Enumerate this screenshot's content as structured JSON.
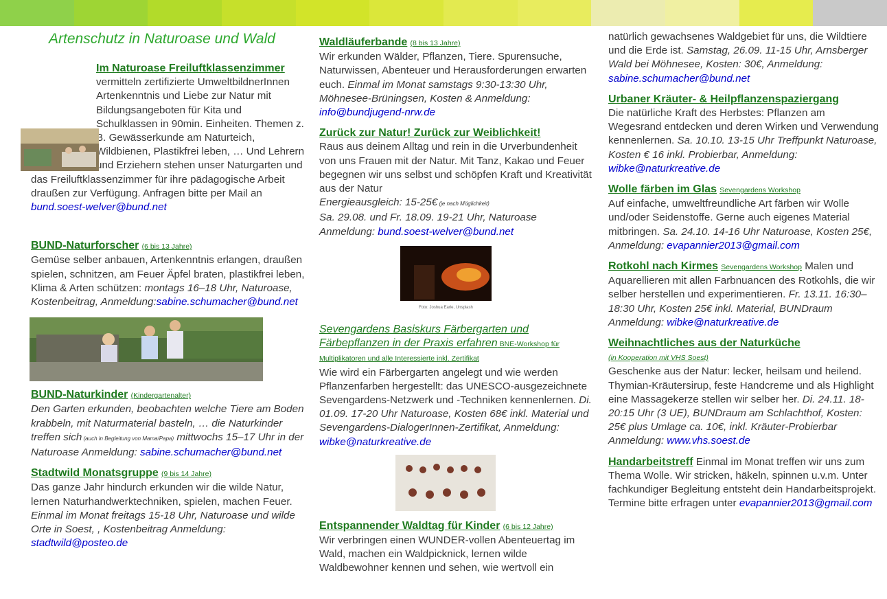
{
  "header_colors": [
    "#8fd14a",
    "#9ed534",
    "#b2db2a",
    "#c6e02b",
    "#d2e429",
    "#dbe73a",
    "#e3ea50",
    "#e8ec5e",
    "#ececb0",
    "#f0f0a2",
    "#e6ec4e",
    "#c9c9c9"
  ],
  "page_title": "Artenschutz in Naturoase und Wald",
  "col1": {
    "s1": {
      "heading": "Im Naturoase Freiluftklassenzimmer",
      "text_a": " vermitteln zertifizierte UmweltbildnerInnen Artenkenntnis und Liebe zur Natur mit Bildungsangeboten für Kita und Schulklassen in 90min. Einheiten. Themen z. B. Gewässerkunde am Naturteich, Wildbienen, Plastikfrei leben, … Und Lehrern und Erziehern stehen unser Naturgarten und das Freiluftklassenzimmer für ihre pädagogische Arbeit draußen zur Verfügung. Anfragen bitte per Mail an ",
      "email": "bund.soest-welver@bund.net"
    },
    "s2": {
      "heading": "BUND-Naturforscher",
      "tag": "(6 bis 13 Jahre)",
      "text": "Gemüse selber anbauen, Artenkenntnis erlangen, draußen spielen, schnitzen, am Feuer Äpfel braten, plastikfrei leben, Klima & Arten schützen:",
      "info": "montags 16–18 Uhr, Naturoase, Kostenbeitrag, Anmeldung:",
      "email": "sabine.schumacher@bund.net"
    },
    "s3": {
      "heading": "BUND-Naturkinder",
      "tag": "(Kindergartenalter)",
      "text_a": "Den Garten erkunden, beobachten welche Tiere am Boden krabbeln, mit Naturmaterial basteln, … die Naturkinder treffen sich",
      "tiny": " (auch in Begleitung von Mama/Papa)",
      "text_b": "mittwochs 15–17 Uhr in der Naturoase Anmeldung:",
      "email": "sabine.schumacher@bund.net"
    },
    "s4": {
      "heading": "Stadtwild Monatsgruppe",
      "tag": "(9 bis 14 Jahre)",
      "text": "Das ganze Jahr hindurch erkunden wir die wilde Natur, lernen Naturhandwerktechniken, spielen, machen Feuer.",
      "info": "Einmal im Monat freitags 15-18 Uhr, Naturoase und wilde Orte in Soest, , Kostenbeitrag Anmeldung:",
      "email": "stadtwild@posteo.de"
    }
  },
  "col2": {
    "s1": {
      "heading": "Waldläuferbande",
      "tag": "(8 bis 13 Jahre)",
      "text": "Wir erkunden Wälder, Pflanzen, Tiere. Spurensuche, Naturwissen, Abenteuer und Herausforderungen erwarten euch.",
      "info": "Einmal im Monat samstags 9:30-13:30 Uhr, Möhnesee-Brüningsen, Kosten & Anmeldung:",
      "email": "info@bundjugend-nrw.de"
    },
    "s2": {
      "heading": "Zurück zur Natur! Zurück zur Weiblichkeit!",
      "text": "Raus aus deinem Alltag und rein in die Urverbundenheit von uns Frauen mit der Natur. Mit Tanz, Kakao und Feuer begegnen wir uns selbst und schöpfen Kraft und Kreativität aus der Natur",
      "info_a": "Energieausgleich: 15-25€",
      "tiny": " (je nach Möglichkeit)",
      "info_b": "Sa. 29.08. und Fr. 18.09. 19-21 Uhr, Naturoase Anmeldung:",
      "email": "bund.soest-welver@bund.net",
      "photo_caption": "Foto: Joshua Earle, Unsplash"
    },
    "s3": {
      "heading": "Sevengardens Basiskurs Färbergarten und Färbepflanzen in der Praxis erfahren",
      "tag": " BNE-Workshop für Multiplikatoren und alle Interessierte inkl. Zertifikat",
      "text": "Wie wird ein Färbergarten angelegt und wie werden Pflanzenfarben hergestellt: das UNESCO-ausgezeichnete Sevengardens-Netzwerk und -Techniken kennenlernen.",
      "info": "Di. 01.09. 17-20 Uhr Naturoase, Kosten 68€ inkl. Material und Sevengardens-DialogerInnen-Zertifikat, Anmeldung:",
      "email": "wibke@naturkreative.de"
    },
    "s4": {
      "heading": "Entspannender Waldtag für Kinder",
      "tag": "(6 bis 12 Jahre)",
      "text": "Wir verbringen einen WUNDER-vollen Abenteuertag im Wald, machen ein Waldpicknick, lernen wilde Waldbewohner kennen und sehen, wie wertvoll ein"
    }
  },
  "col3": {
    "s0": {
      "text": "natürlich gewachsenes Waldgebiet für uns, die Wildtiere und die Erde ist.",
      "info": "Samstag, 26.09. 11-15 Uhr, Arnsberger Wald bei Möhnesee, Kosten: 30€, Anmeldung:",
      "email": "sabine.schumacher@bund.net"
    },
    "s1": {
      "heading": "Urbaner Kräuter- & Heilpflanzenspaziergang",
      "text": "Die natürliche Kraft des Herbstes: Pflanzen am Wegesrand entdecken und deren Wirken und Verwendung kennenlernen.",
      "info": "Sa. 10.10. 13-15 Uhr Treffpunkt Naturoase, Kosten € 16 inkl. Probierbar, Anmeldung:",
      "email": "wibke@naturkreative.de"
    },
    "s2": {
      "heading": "Wolle färben im Glas",
      "tag": "Sevengardens Workshop",
      "text": "Auf einfache, umweltfreundliche Art färben wir Wolle und/oder Seidenstoffe. Gerne auch eigenes Material mitbringen.",
      "info": "Sa. 24.10. 14-16 Uhr Naturoase, Kosten 25€, Anmeldung:",
      "email": "evapannier2013@gmail.com"
    },
    "s3": {
      "heading": "Rotkohl nach Kirmes",
      "tag": "Sevengardens Workshop",
      "text": " Malen und Aquarellieren mit allen Farbnuancen des Rotkohls, die wir selber herstellen und experimentieren.",
      "info": "Fr. 13.11. 16:30–18:30 Uhr, Kosten 25€ inkl. Material, BUNDraum Anmeldung:",
      "email": "wibke@naturkreative.de"
    },
    "s4": {
      "heading": "Weihnachtliches aus der Naturküche",
      "tag": "(in Kooperation mit VHS Soest)",
      "text": "Geschenke aus der Natur: lecker, heilsam und heilend. Thymian-Kräutersirup, feste Handcreme und als Highlight eine Massagekerze stellen wir selber her.",
      "info": "Di. 24.11. 18-20:15 Uhr (3 UE), BUNDraum am Schlachthof, Kosten: 25€ plus Umlage ca. 10€, inkl. Kräuter-Probierbar Anmeldung:",
      "email": "www.vhs.soest.de"
    },
    "s5": {
      "heading": "Handarbeitstreff",
      "text": " Einmal im Monat treffen wir uns zum Thema Wolle. Wir stricken, häkeln, spinnen u.v.m. Unter fachkundiger Begleitung entsteht dein Handarbeitsprojekt. Termine bitte erfragen unter",
      "email": "evapannier2013@gmail.com"
    }
  }
}
